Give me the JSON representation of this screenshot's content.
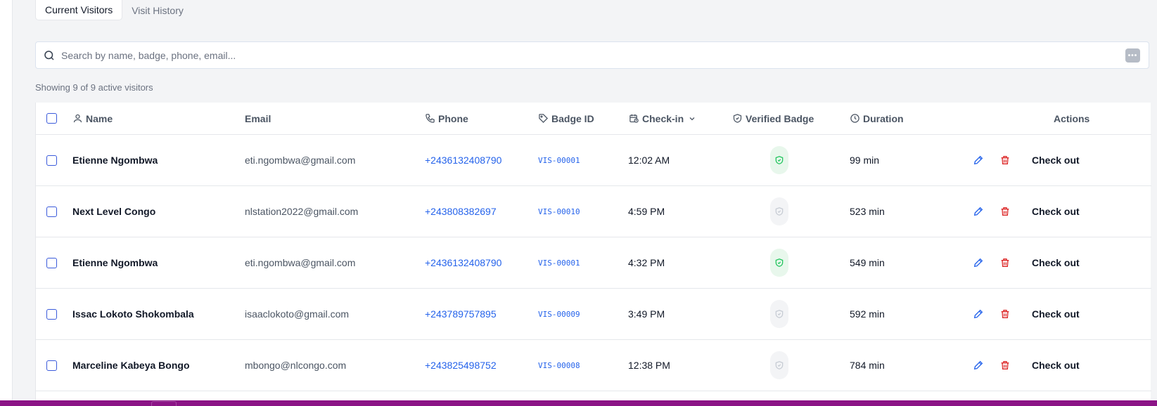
{
  "tabs": [
    {
      "label": "Current Visitors",
      "active": true
    },
    {
      "label": "Visit History",
      "active": false
    }
  ],
  "search": {
    "placeholder": "Search by name, badge, phone, email...",
    "value": ""
  },
  "summary": "Showing 9 of 9 active visitors",
  "columns": {
    "name": "Name",
    "email": "Email",
    "phone": "Phone",
    "badge": "Badge ID",
    "checkin": "Check-in",
    "verified": "Verified Badge",
    "duration": "Duration",
    "actions": "Actions"
  },
  "rows": [
    {
      "name": "Etienne Ngombwa",
      "email": "eti.ngombwa@gmail.com",
      "phone": "+2436132408790",
      "badge": "VIS-00001",
      "checkin": "12:02 AM",
      "verified": true,
      "duration": "99 min",
      "action": "Check out"
    },
    {
      "name": "Next Level Congo",
      "email": "nlstation2022@gmail.com",
      "phone": "+243808382697",
      "badge": "VIS-00010",
      "checkin": "4:59 PM",
      "verified": false,
      "duration": "523 min",
      "action": "Check out"
    },
    {
      "name": "Etienne Ngombwa",
      "email": "eti.ngombwa@gmail.com",
      "phone": "+2436132408790",
      "badge": "VIS-00001",
      "checkin": "4:32 PM",
      "verified": true,
      "duration": "549 min",
      "action": "Check out"
    },
    {
      "name": "Issac Lokoto Shokombala",
      "email": "isaaclokoto@gmail.com",
      "phone": "+243789757895",
      "badge": "VIS-00009",
      "checkin": "3:49 PM",
      "verified": false,
      "duration": "592 min",
      "action": "Check out"
    },
    {
      "name": "Marceline Kabeya Bongo",
      "email": "mbongo@nlcongo.com",
      "phone": "+243825498752",
      "badge": "VIS-00008",
      "checkin": "12:38 PM",
      "verified": false,
      "duration": "784 min",
      "action": "Check out"
    }
  ],
  "colors": {
    "accent": "#2563eb",
    "danger": "#dc2626",
    "verified": "#22c55e",
    "unverified": "#c7ccd4",
    "bottom_bar": "#8b1486"
  },
  "icons": {
    "search": "search-icon",
    "more": "more-options-icon",
    "name": "user-icon",
    "phone": "phone-icon",
    "badge": "tag-icon",
    "checkin": "calendar-clock-icon",
    "sort": "chevron-down-icon",
    "verified": "shield-check-icon",
    "duration": "clock-icon",
    "edit": "pencil-icon",
    "delete": "trash-icon"
  }
}
